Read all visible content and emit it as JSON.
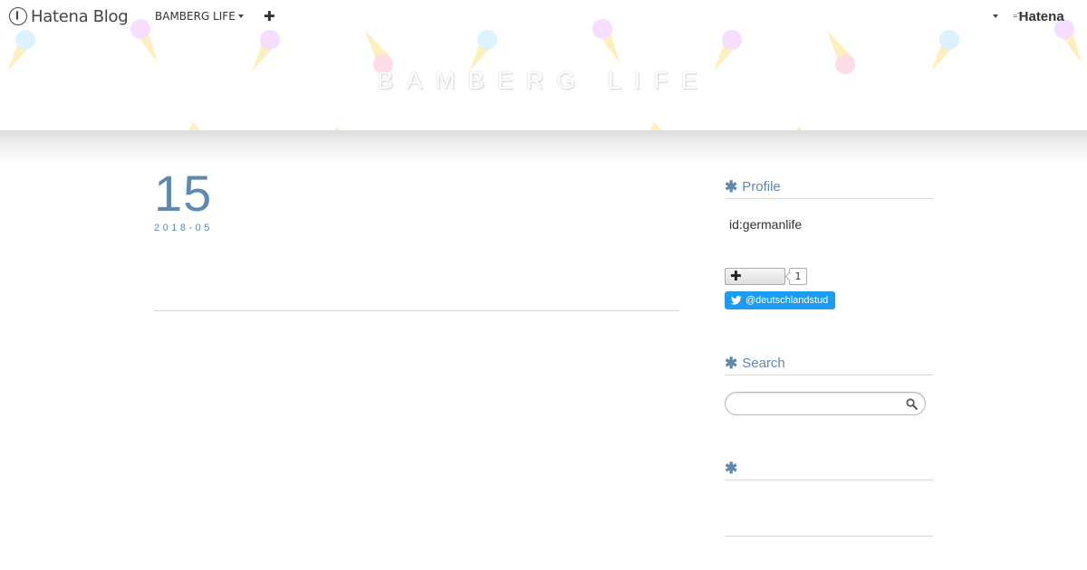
{
  "globalbar": {
    "logo_text": "Hatena Blog",
    "blog_name": "BAMBERG LIFE",
    "add_symbol": "✚",
    "hatena_text": "Hatena"
  },
  "header": {
    "blog_title": "BAMBERG LIFE"
  },
  "entry": {
    "day": "15",
    "year_month": "2018-05"
  },
  "sidebar": {
    "profile_title": "Profile",
    "profile_id": "id:germanlife",
    "subscribe_symbol": "✚",
    "subscriber_count": "1",
    "twitter_handle": "@deutschlandstud",
    "search_title": "Search",
    "search_placeholder": "",
    "third_module_title": ""
  },
  "colors": {
    "accent": "#5f8ab0",
    "twitter": "#1d9bf0",
    "cone": "#fde9a6",
    "scoop_blue": "#cdeeff",
    "scoop_purple": "#f1d4ff",
    "scoop_pink": "#ffd3e2"
  },
  "icons": {
    "asterisk": "✱",
    "search": "search-icon",
    "twitter": "twitter-bird-icon",
    "decor": "ice-cream-cone-icon"
  }
}
